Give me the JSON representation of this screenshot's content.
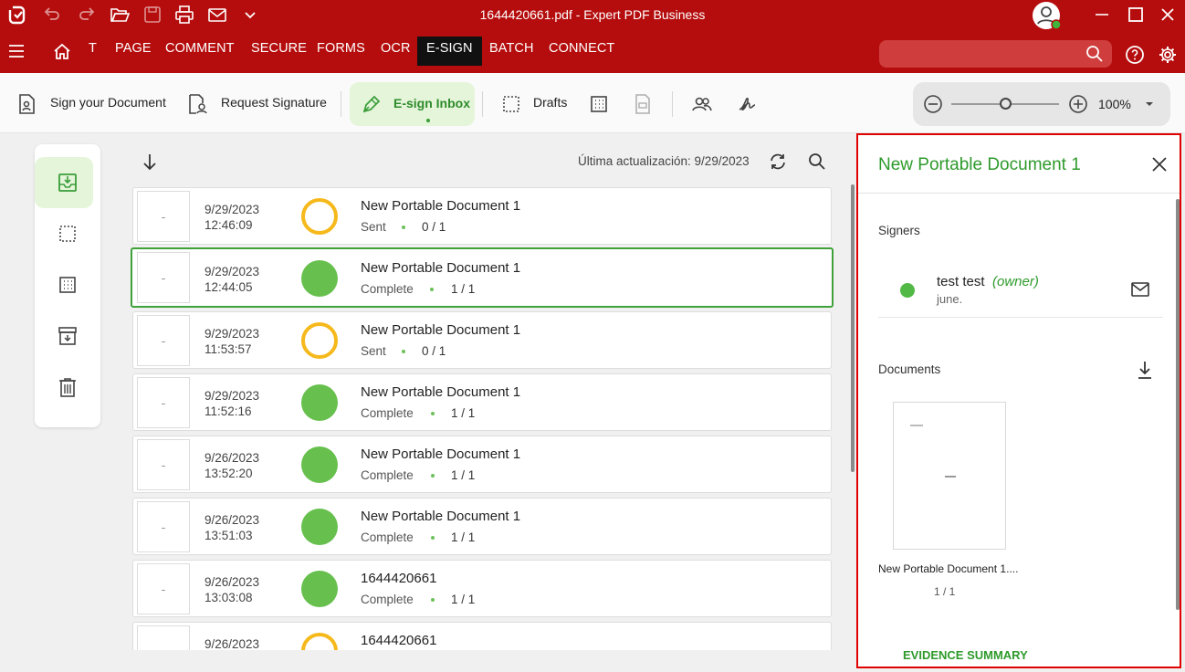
{
  "window": {
    "title": "1644420661.pdf  -  Expert PDF Business"
  },
  "menu": {
    "tabs": [
      "T",
      "PAGE",
      "COMMENT",
      "SECURE",
      "FORMS",
      "OCR",
      "E-SIGN",
      "BATCH",
      "CONNECT"
    ],
    "active": "E-SIGN",
    "search_placeholder": ""
  },
  "toolbar": {
    "sign_document": "Sign your Document",
    "request_signature": "Request Signature",
    "esign_inbox": "E-sign Inbox",
    "drafts": "Drafts",
    "zoom": "100%",
    "zoom_level": 0.5
  },
  "list": {
    "last_update": "Última actualización: 9/29/2023",
    "documents": [
      {
        "date": "9/29/2023",
        "time": "12:46:09",
        "name": "New Portable Document 1",
        "status": "Sent",
        "count": "0 / 1",
        "state": "sent"
      },
      {
        "date": "9/29/2023",
        "time": "12:44:05",
        "name": "New Portable Document 1",
        "status": "Complete",
        "count": "1 / 1",
        "state": "complete"
      },
      {
        "date": "9/29/2023",
        "time": "11:53:57",
        "name": "New Portable Document 1",
        "status": "Sent",
        "count": "0 / 1",
        "state": "sent"
      },
      {
        "date": "9/29/2023",
        "time": "11:52:16",
        "name": "New Portable Document 1",
        "status": "Complete",
        "count": "1 / 1",
        "state": "complete"
      },
      {
        "date": "9/26/2023",
        "time": "13:52:20",
        "name": "New Portable Document 1",
        "status": "Complete",
        "count": "1 / 1",
        "state": "complete"
      },
      {
        "date": "9/26/2023",
        "time": "13:51:03",
        "name": "New Portable Document 1",
        "status": "Complete",
        "count": "1 / 1",
        "state": "complete"
      },
      {
        "date": "9/26/2023",
        "time": "13:03:08",
        "name": "1644420661",
        "status": "Complete",
        "count": "1 / 1",
        "state": "complete"
      },
      {
        "date": "9/26/2023",
        "time": "",
        "name": "1644420661",
        "status": "",
        "count": "",
        "state": "sent"
      }
    ]
  },
  "panel": {
    "title": "New Portable Document 1",
    "signers_label": "Signers",
    "signer_name": "test test",
    "signer_role": "(owner)",
    "signer_note": "june.",
    "documents_label": "Documents",
    "doc_caption": "New Portable Document 1....",
    "doc_pages": "1 / 1",
    "evidence": "EVIDENCE SUMMARY"
  },
  "colors": {
    "brand": "#b50d0d",
    "accent": "#3fa13a",
    "sent": "#f6b91c",
    "complete": "#67c04e"
  }
}
